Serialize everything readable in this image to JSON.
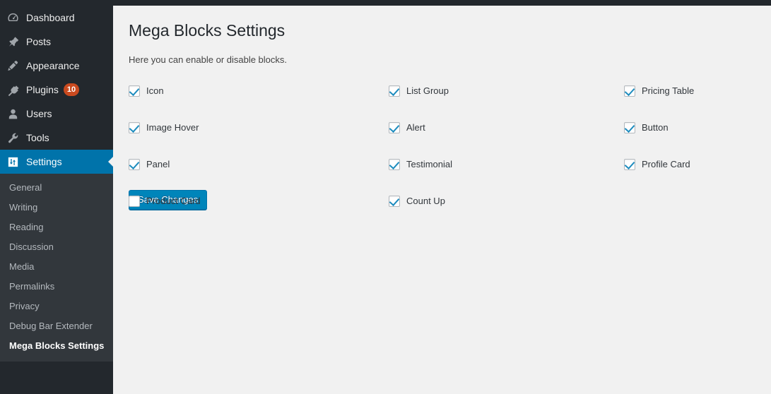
{
  "sidebar": {
    "menu": [
      {
        "label": "Dashboard",
        "icon": "dashboard-gauge-icon",
        "current": false,
        "badge": null
      },
      {
        "label": "Posts",
        "icon": "pushpin-icon",
        "current": false,
        "badge": null
      },
      {
        "label": "Appearance",
        "icon": "paintbrush-icon",
        "current": false,
        "badge": null
      },
      {
        "label": "Plugins",
        "icon": "plug-icon",
        "current": false,
        "badge": "10"
      },
      {
        "label": "Users",
        "icon": "user-icon",
        "current": false,
        "badge": null
      },
      {
        "label": "Tools",
        "icon": "wrench-icon",
        "current": false,
        "badge": null
      },
      {
        "label": "Settings",
        "icon": "settings-sliders-icon",
        "current": true,
        "badge": null
      }
    ],
    "submenu": [
      {
        "label": "General",
        "current": false
      },
      {
        "label": "Writing",
        "current": false
      },
      {
        "label": "Reading",
        "current": false
      },
      {
        "label": "Discussion",
        "current": false
      },
      {
        "label": "Media",
        "current": false
      },
      {
        "label": "Permalinks",
        "current": false
      },
      {
        "label": "Privacy",
        "current": false
      },
      {
        "label": "Debug Bar Extender",
        "current": false
      },
      {
        "label": "Mega Blocks Settings",
        "current": true
      }
    ],
    "colors": {
      "background": "#23282d",
      "submenu_background": "#32373c",
      "current_background": "#0073aa",
      "badge_background": "#ca4a1f"
    }
  },
  "main": {
    "title": "Mega Blocks Settings",
    "description": "Here you can enable or disable blocks.",
    "columns": [
      {
        "items": [
          {
            "label": "Icon",
            "checked": true
          },
          {
            "label": "Image Hover",
            "checked": true
          },
          {
            "label": "Panel",
            "checked": true
          },
          {
            "label": "Product Card",
            "checked": false
          }
        ]
      },
      {
        "items": [
          {
            "label": "List Group",
            "checked": true
          },
          {
            "label": "Alert",
            "checked": true
          },
          {
            "label": "Testimonial",
            "checked": true
          },
          {
            "label": "Count Up",
            "checked": true
          }
        ]
      },
      {
        "items": [
          {
            "label": "Pricing Table",
            "checked": true
          },
          {
            "label": "Button",
            "checked": true
          },
          {
            "label": "Profile Card",
            "checked": true
          }
        ]
      }
    ],
    "save_label": "Save Changes",
    "colors": {
      "page_background": "#f1f1f1",
      "button_background": "#0085ba",
      "checkmark": "#1e8cbe"
    }
  }
}
